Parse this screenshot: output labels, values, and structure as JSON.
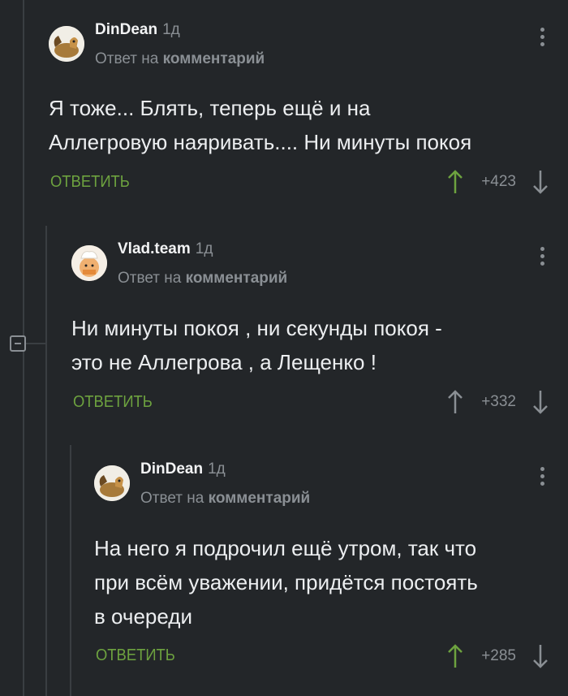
{
  "comments": [
    {
      "author": "DinDean",
      "time": "1д",
      "reply_prefix": "Ответ на",
      "reply_target": "комментарий",
      "text": "Я тоже... Блять, теперь ещё и на\nАллегровую наяривать.... Ни минуты покоя",
      "reply_label": "ОТВЕТИТЬ",
      "rating": "+423",
      "upvoted": true,
      "avatar_icon": "horse-avatar-icon"
    },
    {
      "author": "Vlad.team",
      "time": "1д",
      "reply_prefix": "Ответ на",
      "reply_target": "комментарий",
      "text": "Ни минуты покоя , ни секунды покоя -\nэто не Аллегрова , а Лещенко !",
      "reply_label": "ОТВЕТИТЬ",
      "rating": "+332",
      "upvoted": false,
      "avatar_icon": "chef-avatar-icon"
    },
    {
      "author": "DinDean",
      "time": "1д",
      "reply_prefix": "Ответ на",
      "reply_target": "комментарий",
      "text": "На него я подрочил ещё утром, так что\nпри всём уважении, придётся постоять\nв очереди",
      "reply_label": "ОТВЕТИТЬ",
      "rating": "+285",
      "upvoted": true,
      "avatar_icon": "horse-avatar-icon"
    }
  ],
  "colors": {
    "background": "#232629",
    "reply_green": "#6da23f",
    "muted": "#8a8f94",
    "upvote_active": "#6da23f"
  },
  "icons": [
    "collapse-thread-icon",
    "more-options-icon",
    "upvote-arrow-icon",
    "downvote-arrow-icon"
  ]
}
